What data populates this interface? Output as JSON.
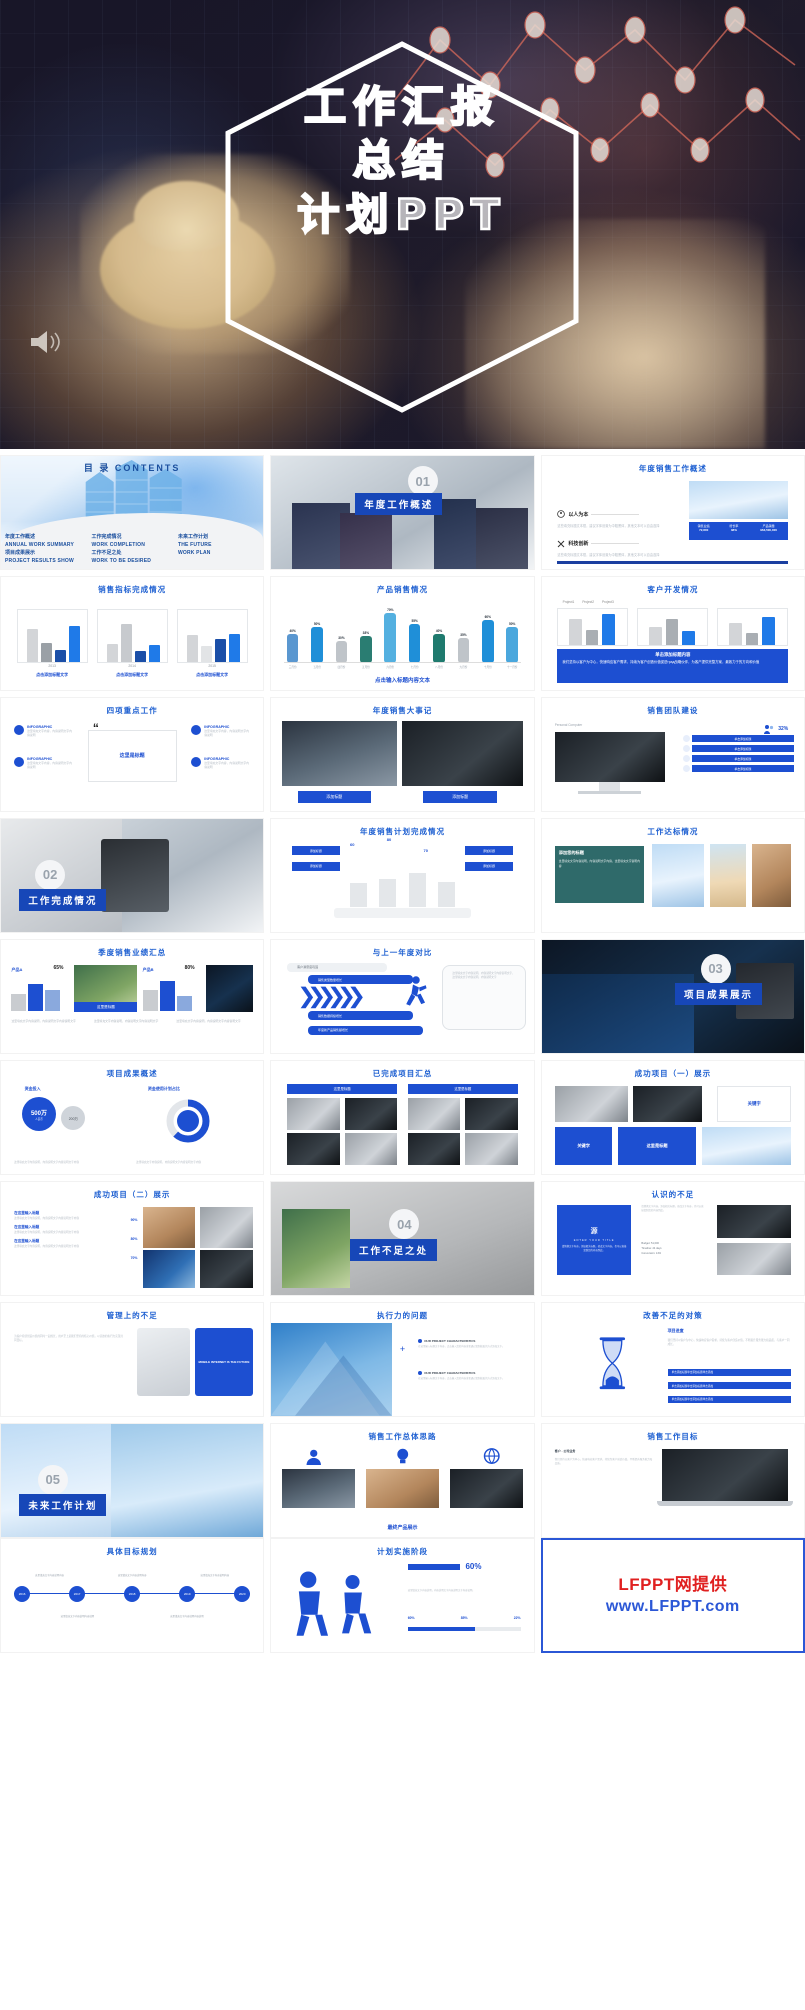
{
  "hero": {
    "title_lines": [
      "工作汇报",
      "总结",
      "计划PPT"
    ],
    "speaker_icon": "speaker-icon"
  },
  "contents_slide": {
    "title_cn": "目 录",
    "title_en": "CONTENTS",
    "columns": [
      {
        "cn1": "年度工作概述",
        "en1": "ANNUAL WORK SUMMARY",
        "cn2": "项目成果展示",
        "en2": "PROJECT RESULTS SHOW"
      },
      {
        "cn1": "工作完成情况",
        "en1": "WORK COMPLETION",
        "cn2": "工作不足之处",
        "en2": "WORK TO BE DESIRED"
      },
      {
        "cn1": "未来工作计划",
        "en1": "THE FUTURE",
        "cn2": "",
        "en2": "WORK PLAN"
      }
    ]
  },
  "sections": [
    {
      "num": "01",
      "label": "年度工作概述"
    },
    {
      "num": "02",
      "label": "工作完成情况"
    },
    {
      "num": "03",
      "label": "项目成果展示"
    },
    {
      "num": "04",
      "label": "工作不足之处"
    },
    {
      "num": "05",
      "label": "未来工作计划"
    }
  ],
  "slides": [
    {
      "id": "s-overview",
      "title": "年度销售工作概述",
      "sub": [
        "以人为本",
        "科技创新"
      ],
      "stat_labels": [
        "销售业绩",
        "增长率",
        "产品销量"
      ],
      "stat_values": [
        "72,800",
        "38%",
        "¥63,500,000"
      ]
    },
    {
      "id": "s-target",
      "title": "销售指标完成情况",
      "groups": [
        "2013",
        "2014",
        "2015"
      ],
      "footers": [
        "点击添加标题文字",
        "点击添加标题文字",
        "点击添加标题文字"
      ]
    },
    {
      "id": "s-product",
      "title": "产品销售情况",
      "footer": "点击输入标题内容文本",
      "categories": [
        "三月份",
        "五月份",
        "四月份",
        "五月份",
        "六月份",
        "七月份",
        "八月份",
        "九月份",
        "十月份",
        "十一月份"
      ],
      "values": [
        40,
        50,
        30,
        38,
        70,
        55,
        40,
        35,
        60,
        50
      ]
    },
    {
      "id": "s-customer",
      "title": "客户开发情况",
      "legend": [
        "Project1",
        "Project2",
        "Project3"
      ],
      "body_title": "单击添加标题内容",
      "body": "我们坚持以客户为中心，快速响应客户需求，持续为客户创造价值促进град战略伙伴，为客户提供完整方案，最致力于的方向和价值"
    },
    {
      "id": "s-fourkey",
      "title": "四项重点工作",
      "center": "这里是标题",
      "items": [
        "INFOGRAPHIC",
        "INFOGRAPHIC",
        "INFOGRAPHIC",
        "INFOGRAPHIC"
      ]
    },
    {
      "id": "s-events",
      "title": "年度销售大事记",
      "buttons": [
        "添加标题",
        "添加标题"
      ]
    },
    {
      "id": "s-team",
      "title": "销售团队建设",
      "percent": "32%",
      "rows": [
        "单击添加标题",
        "单击添加标题",
        "单击添加标题",
        "单击添加标题"
      ],
      "device": "Personal Computer"
    },
    {
      "id": "s-plan-achieve",
      "title": "年度销售计划完成情况",
      "bars": [
        60,
        70,
        80,
        60
      ],
      "tags": [
        "添加标题",
        "添加标题",
        "添加标题",
        "添加标题"
      ]
    },
    {
      "id": "s-goal",
      "title": "工作达标情况",
      "tag": "添加您的标题"
    },
    {
      "id": "s-quarter",
      "title": "季度销售业绩汇总",
      "left_label": "产品A",
      "right_label": "产品B",
      "left_pct": "65%",
      "right_pct": "80%",
      "banner": "这里是标题"
    },
    {
      "id": "s-compare",
      "title": "与上一年度对比",
      "steps": [
        "客户满意度巩固",
        "销售类型数量增长",
        "销售数据持续增长",
        "年度新产品销售额增长"
      ]
    },
    {
      "id": "s-outcome",
      "title": "项目成果概述",
      "money": "500万",
      "money_sub": "资金投入",
      "donut_label": "资金使用计划占比"
    },
    {
      "id": "s-done",
      "title": "已完成项目汇总",
      "tabs": [
        "这里是标题",
        "这里是标题"
      ]
    },
    {
      "id": "s-success1",
      "title": "成功项目（一）展示",
      "badge": "关键字",
      "badge2": "关键字",
      "cta": "这里是标题"
    },
    {
      "id": "s-success2",
      "title": "成功项目（二）展示",
      "bullets": [
        "在这里输入标题",
        "在这里输入标题",
        "在这里输入标题"
      ],
      "pcts": [
        "90%",
        "80%",
        "70%"
      ]
    },
    {
      "id": "s-gap",
      "title": "认识的不足",
      "tag": "源",
      "tag_en": "ENTER YOUR TITLE",
      "kv": [
        "Budget: 51,000",
        "Timeline: 24 days",
        "Conversion: 14%"
      ]
    },
    {
      "id": "s-mgmt",
      "title": "管理上的不足",
      "mobile": "MOBILE INTERNET IS THE FUTURE"
    },
    {
      "id": "s-exec",
      "title": "执行力的问题",
      "blocks": [
        "OUR PROJECT CHARACTERISTICS",
        "OUR PROJECT CHARACTERISTICS"
      ]
    },
    {
      "id": "s-improve",
      "title": "改善不足的对策",
      "head": "项目进度"
    },
    {
      "id": "s-channel",
      "title": "销售工作总体思路",
      "sub": "最终产品展示"
    },
    {
      "id": "s-workgoal",
      "title": "销售工作目标",
      "note": "客户 · 公司业务"
    },
    {
      "id": "s-roadmap",
      "title": "具体目标规划",
      "nodes": [
        "2016",
        "2017",
        "2018",
        "2019",
        "2020"
      ]
    },
    {
      "id": "s-stage",
      "title": "计划实施阶段",
      "big": "60%",
      "small": [
        "60%",
        "85%",
        "22%"
      ]
    }
  ],
  "watermark": {
    "line1": "LFPPT网提供",
    "line2": "www.LFPPT.com",
    "color1": "#e02020",
    "color2": "#2b57d6"
  }
}
